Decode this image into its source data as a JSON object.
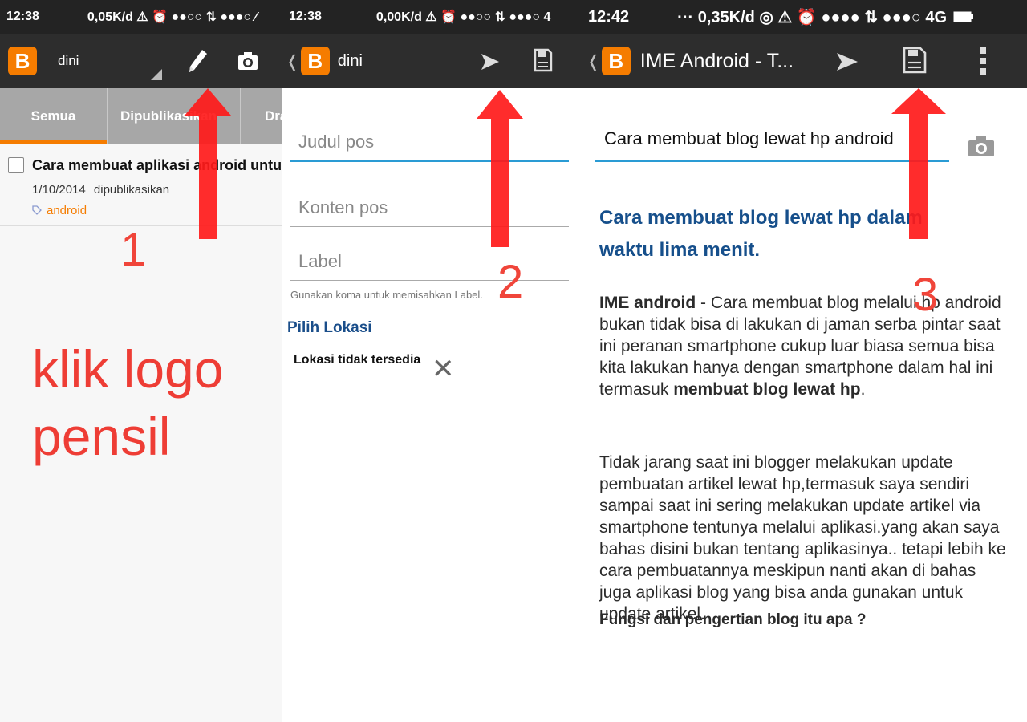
{
  "panel1": {
    "status": {
      "time": "12:38",
      "right": "0,05K/d ⚠ ⏰ ●●○○ ⇅ ●●●○ ⁄"
    },
    "appbar": {
      "blog_name": "dini"
    },
    "tabs": [
      {
        "label": "Semua"
      },
      {
        "label": "Dipublikasikan"
      },
      {
        "label": "Draf"
      }
    ],
    "post": {
      "title": "Cara membuat aplikasi android untuk blog",
      "date": "1/10/2014",
      "status": "dipublikasikan",
      "label": "android"
    },
    "step_number": "1",
    "instruction": "klik logo pensil"
  },
  "panel2": {
    "status": {
      "time": "12:38",
      "right": "0,00K/d ⚠ ⏰ ●●○○ ⇅ ●●●○ 4"
    },
    "appbar": {
      "blog_name": "dini"
    },
    "fields": {
      "title_placeholder": "Judul pos",
      "content_placeholder": "Konten pos",
      "label_placeholder": "Label"
    },
    "hint": "Gunakan koma untuk memisahkan Label.",
    "location_heading": "Pilih Lokasi",
    "location_text": "Lokasi tidak tersedia",
    "step_number": "2"
  },
  "panel3": {
    "status": {
      "time": "12:42",
      "right": "··· 0,35K/d ◎ ⚠ ⏰ ●●●● ⇅ ●●●○ 4G"
    },
    "appbar": {
      "blog_name": "IME Android - T..."
    },
    "title_value": "Cara membuat blog lewat hp android",
    "heading": "Cara membuat blog lewat hp dalam waktu lima menit.",
    "para1": {
      "lead": "IME android",
      "text": " - Cara membuat blog melalui hp android bukan tidak bisa di lakukan di jaman serba pintar saat ini peranan smartphone cukup luar biasa semua bisa kita lakukan hanya dengan smartphone dalam hal ini termasuk ",
      "bold_end": "membuat blog lewat hp",
      "end": "."
    },
    "para2": "Tidak jarang saat ini blogger melakukan update pembuatan artikel lewat hp,termasuk saya sendiri sampai saat ini sering melakukan update artikel via smartphone tentunya melalui aplikasi.yang akan saya bahas disini bukan tentang aplikasinya.. tetapi lebih ke cara pembuatannya meskipun nanti akan di bahas juga aplikasi blog yang bisa anda gunakan untuk update artikel.",
    "subheading": "Fungsi dan pengertian blog itu apa ?",
    "step_number": "3"
  },
  "colors": {
    "accent": "#f57c00",
    "arrow": "#ff1a1a",
    "annotation": "#ee3d35",
    "link_blue": "#164f8b",
    "focus_line": "#2a9bd4"
  },
  "icons": [
    "blogger-logo-icon",
    "pencil-icon",
    "camera-icon",
    "send-icon",
    "save-icon",
    "more-vert-icon",
    "close-icon",
    "tag-icon",
    "back-chevron-icon",
    "arrow-up-icon"
  ]
}
